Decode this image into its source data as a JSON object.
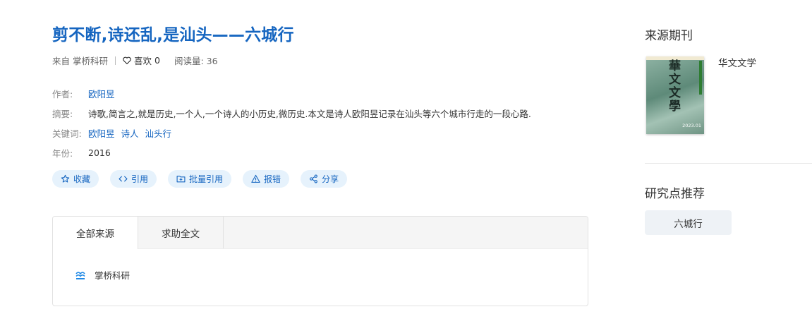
{
  "article": {
    "title": "剪不断,诗还乱,是汕头——六城行",
    "source_prefix": "来自",
    "source_name": "掌桥科研",
    "like_label": "喜欢",
    "like_count": "0",
    "views_label": "阅读量:",
    "views_count": "36"
  },
  "info": {
    "author_label": "作者:",
    "author": "欧阳昱",
    "abstract_label": "摘要:",
    "abstract": "诗歌,简言之,就是历史,一个人,一个诗人的小历史,微历史.本文是诗人欧阳昱记录在汕头等六个城市行走的一段心路.",
    "keywords_label": "关键词:",
    "keywords": [
      "欧阳昱",
      "诗人",
      "汕头行"
    ],
    "year_label": "年份:",
    "year": "2016"
  },
  "actions": {
    "collect": "收藏",
    "cite": "引用",
    "batch_cite": "批量引用",
    "report": "报错",
    "share": "分享"
  },
  "sources_panel": {
    "tabs": [
      "全部来源",
      "求助全文"
    ],
    "items": [
      {
        "name": "掌桥科研"
      }
    ]
  },
  "sidebar": {
    "journal_heading": "来源期刊",
    "journal_name": "华文文学",
    "cover_title": "華文文學",
    "cover_issue": "2023.01",
    "research_heading": "研究点推荐",
    "research_tags": [
      "六城行"
    ]
  },
  "colors": {
    "accent": "#1565c0",
    "button_bg": "#e6f2fc",
    "tag_bg": "#eef2f6"
  }
}
